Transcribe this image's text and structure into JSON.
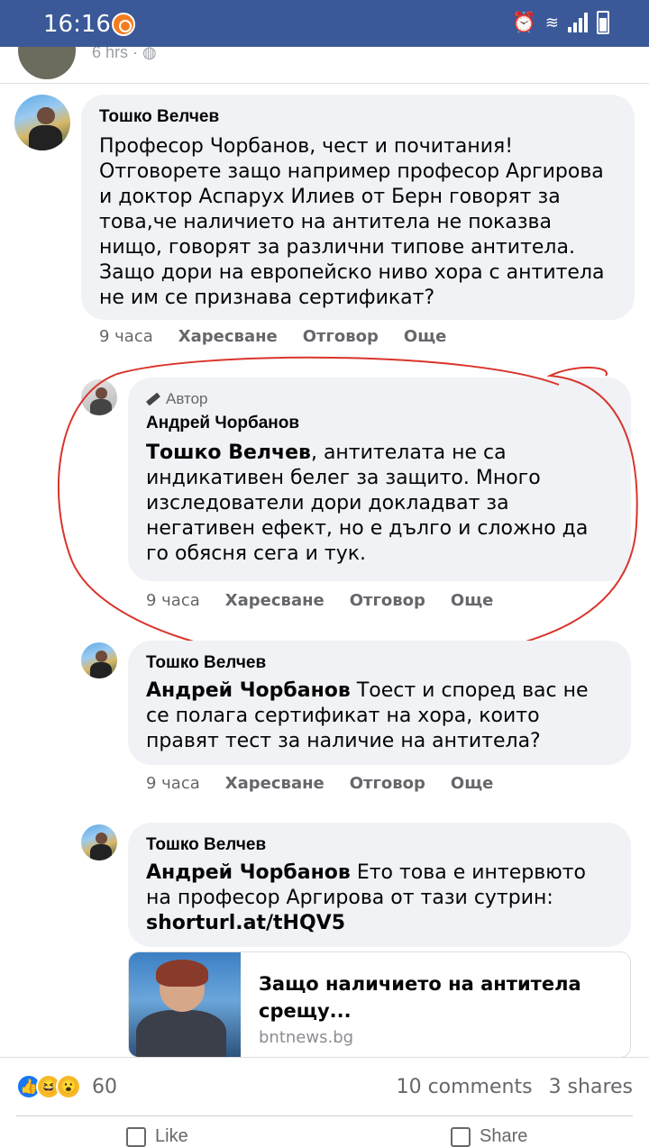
{
  "status_bar": {
    "time": "16:16",
    "app_icon": "notification-app-icon",
    "icons": [
      "alarm-icon",
      "wifi-icon",
      "signal-icon",
      "battery-icon"
    ]
  },
  "post_header": {
    "time_meta": "6 hrs ·",
    "privacy_icon": "globe-icon"
  },
  "comments": [
    {
      "author": "Тошко Велчев",
      "text": "Професор Чорбанов, чест и почитания! Отговорете защо например професор Аргирова и доктор Аспарух Илиев от Берн говорят за това,че наличието на антитела не показва нищо, говорят за различни типове антитела. Защо дори на европейско ниво хора с антитела не им се признава сертификат?",
      "time": "9 часа",
      "like": "Харесване",
      "reply": "Отговор",
      "more": "Още"
    },
    {
      "badge": "Автор",
      "author": "Андрей Чорбанов",
      "mention": "Тошко Велчев",
      "text": ", антителата не са индикативен белег за защито. Много изследователи дори докладват за негативен ефект, но е дълго и сложно да го обясня сега и тук.",
      "time": "9 часа",
      "like": "Харесване",
      "reply": "Отговор",
      "more": "Още"
    },
    {
      "author": "Тошко Велчев",
      "mention": "Андрей Чорбанов",
      "text": " Тоест и според вас не се полага сертификат на хора, които правят тест за наличие на антитела?",
      "time": "9 часа",
      "like": "Харесване",
      "reply": "Отговор",
      "more": "Още"
    },
    {
      "author": "Тошко Велчев",
      "mention": "Андрей Чорбанов",
      "text": " Ето това е интервюто на професор Аргирова от тази сутрин:",
      "link_text": "shorturl.at/tHQV5"
    }
  ],
  "link_preview": {
    "title": "Защо наличието на антитела срещу...",
    "domain": "bntnews.bg"
  },
  "footer": {
    "reactions": [
      "like",
      "haha",
      "wow"
    ],
    "reaction_count": "60",
    "comments": "10 comments",
    "shares": "3 shares",
    "like_label": "Like",
    "share_label": "Share"
  },
  "highlight_color": "#d9342b"
}
